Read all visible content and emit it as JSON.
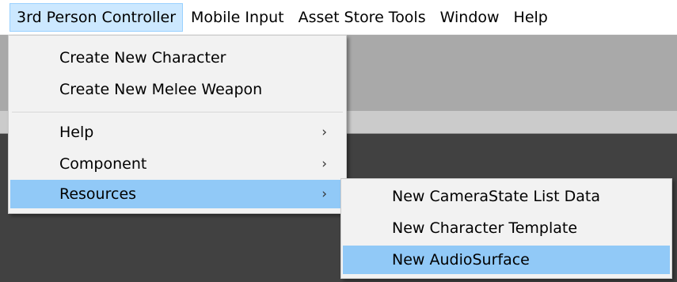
{
  "menubar": {
    "items": [
      {
        "label": "3rd Person Controller",
        "active": true
      },
      {
        "label": "Mobile Input",
        "active": false
      },
      {
        "label": "Asset Store Tools",
        "active": false
      },
      {
        "label": "Window",
        "active": false
      },
      {
        "label": "Help",
        "active": false
      }
    ]
  },
  "menu": {
    "items": [
      {
        "label": "Create New Character"
      },
      {
        "label": "Create New Melee Weapon"
      },
      {
        "label": "Help",
        "submenu_arrow": "›"
      },
      {
        "label": "Component",
        "submenu_arrow": "›"
      },
      {
        "label": "Resources",
        "submenu_arrow": "›",
        "highlighted": true
      }
    ]
  },
  "submenu": {
    "items": [
      {
        "label": "New CameraState List Data"
      },
      {
        "label": "New Character Template"
      },
      {
        "label": "New AudioSurface",
        "highlighted": true
      }
    ]
  },
  "colors": {
    "highlight": "#91c9f7",
    "menubar_active": "#cce8ff",
    "menu_bg": "#f2f2f2"
  }
}
